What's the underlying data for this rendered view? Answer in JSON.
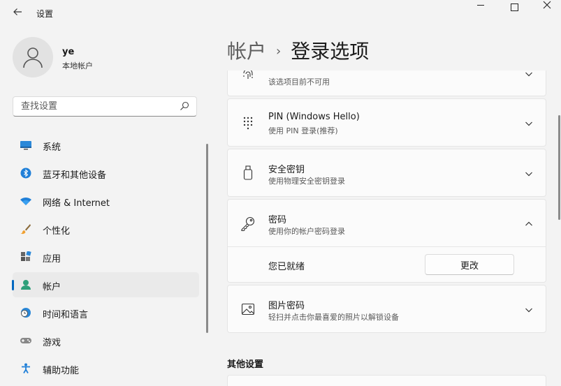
{
  "window": {
    "title": "设置",
    "back_icon": "arrow-left-icon",
    "minimize_icon": "minimize-icon",
    "maximize_icon": "maximize-icon",
    "close_icon": "close-icon"
  },
  "profile": {
    "name": "ye",
    "account_type": "本地帐户",
    "avatar_icon": "user-avatar-icon"
  },
  "search": {
    "placeholder": "查找设置",
    "icon": "search-icon"
  },
  "nav": {
    "items": [
      {
        "label": "系统",
        "icon": "system-display-icon",
        "active": false
      },
      {
        "label": "蓝牙和其他设备",
        "icon": "bluetooth-icon",
        "active": false
      },
      {
        "label": "网络 & Internet",
        "icon": "wifi-icon",
        "active": false
      },
      {
        "label": "个性化",
        "icon": "brush-icon",
        "active": false
      },
      {
        "label": "应用",
        "icon": "apps-icon",
        "active": false
      },
      {
        "label": "帐户",
        "icon": "account-icon",
        "active": true
      },
      {
        "label": "时间和语言",
        "icon": "globe-clock-icon",
        "active": false
      },
      {
        "label": "游戏",
        "icon": "gamepad-icon",
        "active": false
      },
      {
        "label": "辅助功能",
        "icon": "accessibility-icon",
        "active": false
      }
    ]
  },
  "breadcrumb": {
    "parent": "帐户",
    "separator": "›",
    "current": "登录选项"
  },
  "options": [
    {
      "title": "",
      "subtitle": "该选项目前不可用",
      "icon": "fingerprint-icon",
      "expanded": false
    },
    {
      "title": "PIN (Windows Hello)",
      "subtitle": "使用 PIN 登录(推荐)",
      "icon": "pin-keypad-icon",
      "expanded": false
    },
    {
      "title": "安全密钥",
      "subtitle": "使用物理安全密钥登录",
      "icon": "usb-key-icon",
      "expanded": false
    },
    {
      "title": "密码",
      "subtitle": "使用你的帐户密码登录",
      "icon": "key-icon",
      "expanded": true
    },
    {
      "title": "图片密码",
      "subtitle": "轻扫并点击你最喜爱的照片以解锁设备",
      "icon": "picture-icon",
      "expanded": false
    }
  ],
  "password_panel": {
    "status": "您已就绪",
    "button_label": "更改"
  },
  "other_settings": {
    "heading": "其他设置"
  },
  "colors": {
    "accent": "#0067c0",
    "background": "#f3f3f3",
    "card": "#fbfbfb"
  }
}
